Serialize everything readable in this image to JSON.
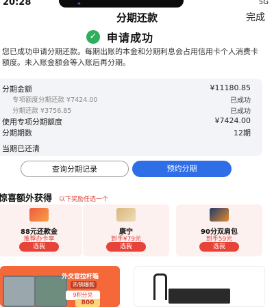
{
  "status": {
    "time": "20:28",
    "indicators": "5G"
  },
  "nav": {
    "title": "分期还款",
    "done": "完成"
  },
  "success": {
    "title": "申请成功"
  },
  "description": "您已成功申请分期还款。每期出账的本金和分期利息会占用信用卡个人消费卡额度。未入账金额会等入账后再分期。",
  "details": [
    {
      "label": "分期金额",
      "value": "¥11180.85",
      "sub": false
    },
    {
      "label": "专项额度分期还款 ¥7424.00",
      "value": "已成功",
      "sub": true
    },
    {
      "label": "分期还款 ¥3756.85",
      "value": "已成功",
      "sub": true
    },
    {
      "label": "使用专项分期额度",
      "value": "¥7424.00",
      "sub": false
    },
    {
      "label": "分期期数",
      "value": "12期",
      "sub": false
    },
    {
      "label": "当期已还清",
      "value": "",
      "sub": false
    }
  ],
  "actions": {
    "record": "查询分期记录",
    "reserve": "预约分期"
  },
  "gifts": {
    "title": "惊喜额外获得",
    "subtitle": "以下奖励任选一个",
    "items": [
      {
        "name": "88元还款金",
        "note": "推荐办卡享",
        "button": "选我",
        "icon": "gift-box-icon"
      },
      {
        "name": "康宁",
        "note": "到手¥79元",
        "button": "选我",
        "icon": "cookware-icon"
      },
      {
        "name": "90分双肩包",
        "note": "到手59元",
        "button": "选我",
        "icon": "backpack-icon"
      }
    ]
  },
  "banner_left": {
    "title": "外交官拉杆箱",
    "hot": "热销爆款",
    "coupon": "9积分兑",
    "big": "800"
  }
}
